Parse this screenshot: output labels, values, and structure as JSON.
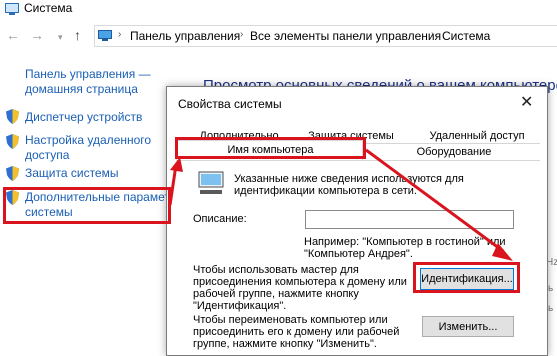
{
  "window": {
    "title": "Система"
  },
  "address": {
    "crumbs": [
      "Панель управления",
      "Все элементы панели управления",
      "Система"
    ]
  },
  "sidebar": {
    "home_line1": "Панель управления —",
    "home_line2": "домашняя страница",
    "items": [
      {
        "label_line1": "Диспетчер устройств",
        "label_line2": ""
      },
      {
        "label_line1": "Настройка удаленного",
        "label_line2": "доступа"
      },
      {
        "label_line1": "Защита системы",
        "label_line2": ""
      },
      {
        "label_line1": "Дополнительные параметры",
        "label_line2": "системы"
      }
    ]
  },
  "main": {
    "heading": "Просмотр основных сведений о вашем компьютере",
    "edge_glyphs": [
      "Hz",
      "ь",
      "ь"
    ]
  },
  "dialog": {
    "title": "Свойства системы",
    "close_glyph": "✕",
    "tabs_back": [
      "Дополнительно",
      "Защита системы",
      "Удаленный доступ"
    ],
    "tabs_front": [
      "Имя компьютера",
      "Оборудование"
    ],
    "info_line1": "Указанные ниже сведения используются для",
    "info_line2": "идентификации компьютера в сети.",
    "description_label": "Описание:",
    "description_value": "",
    "example_line1": "Например: \"Компьютер в гостиной\" или",
    "example_line2": "\"Компьютер Андрея\".",
    "wizard_line1": "Чтобы использовать мастер для",
    "wizard_line2": "присоединения компьютера к домену или",
    "wizard_line3": "рабочей группе, нажмите кнопку",
    "wizard_line4": "\"Идентификация\".",
    "ident_button": "Идентификация...",
    "rename_line1": "Чтобы переименовать компьютер или",
    "rename_line2": "присоединить его к домену или рабочей",
    "rename_line3": "группе, нажмите кнопку \"Изменить\".",
    "change_button": "Изменить..."
  },
  "colors": {
    "annotation_red": "#d9141e",
    "link_blue": "#1a5fb4",
    "heading_blue": "#1e3287"
  },
  "icons": [
    "system-icon",
    "back-arrow-icon",
    "forward-arrow-icon",
    "up-arrow-icon",
    "monitor-icon",
    "shield-icon",
    "close-icon",
    "computer-icon"
  ]
}
